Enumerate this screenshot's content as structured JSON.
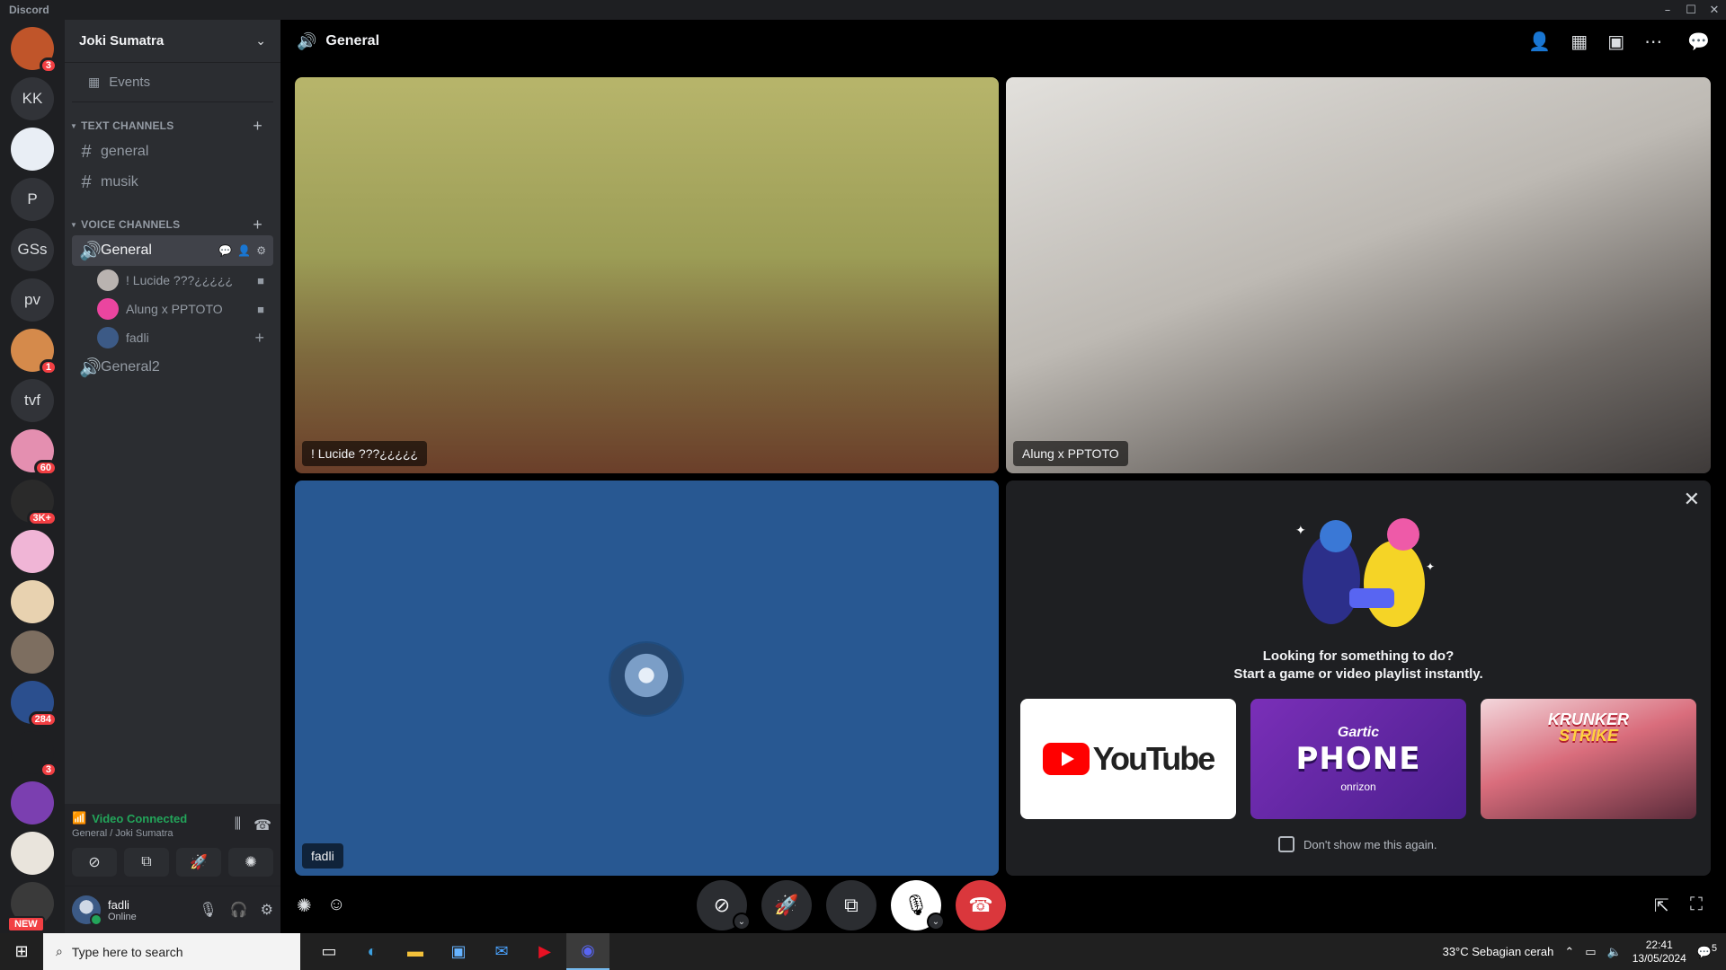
{
  "window": {
    "app_name": "Discord"
  },
  "guilds": [
    {
      "label": "",
      "badge": "3",
      "color": "#c0552a"
    },
    {
      "label": "KK",
      "badge": "",
      "color": "#313338"
    },
    {
      "label": "",
      "badge": "",
      "color": "#e9eef5"
    },
    {
      "label": "P",
      "badge": "",
      "color": "#313338"
    },
    {
      "label": "GSs",
      "badge": "",
      "color": "#313338"
    },
    {
      "label": "pv",
      "badge": "",
      "color": "#313338"
    },
    {
      "label": "",
      "badge": "1",
      "color": "#d58a4b"
    },
    {
      "label": "tvf",
      "badge": "",
      "color": "#313338"
    },
    {
      "label": "",
      "badge": "60",
      "color": "#e48fb0"
    },
    {
      "label": "",
      "badge": "3K+",
      "color": "#2a2a2a"
    },
    {
      "label": "",
      "badge": "",
      "color": "#f0b5d6"
    },
    {
      "label": "",
      "badge": "",
      "color": "#e8d2b0"
    },
    {
      "label": "",
      "badge": "",
      "color": "#7d6e60"
    },
    {
      "label": "",
      "badge": "284",
      "color": "#2b4f8e"
    },
    {
      "label": "",
      "badge": "3",
      "color": "#1e1f22"
    },
    {
      "label": "",
      "badge": "",
      "color": "#7b3fb0"
    },
    {
      "label": "",
      "badge": "",
      "color": "#e9e4dc"
    },
    {
      "label": "",
      "badge": "",
      "color": "#3a3a3a",
      "new": "NEW"
    }
  ],
  "sidebar": {
    "guild_name": "Joki Sumatra",
    "events_label": "Events",
    "text_category": "TEXT CHANNELS",
    "text_channels": [
      "general",
      "musik"
    ],
    "voice_category": "VOICE CHANNELS",
    "voice_channels": [
      "General",
      "General2"
    ],
    "members": [
      {
        "name": "! Lucide ???¿¿¿¿¿",
        "color": "#b9b3b0"
      },
      {
        "name": "Alung x PPTOTO",
        "color": "#eb459f"
      },
      {
        "name": "fadli",
        "color": "#3c5a86"
      }
    ]
  },
  "voice_panel": {
    "status": "Video Connected",
    "location": "General / Joki Sumatra"
  },
  "user_panel": {
    "name": "fadli",
    "status": "Online"
  },
  "header": {
    "channel": "General"
  },
  "tiles": {
    "lucide_name": "! Lucide ???¿¿¿¿¿",
    "alung_name": "Alung x PPTOTO",
    "fadli_name": "fadli"
  },
  "activity": {
    "line1": "Looking for something to do?",
    "line2": "Start a game or video playlist instantly.",
    "youtube_label": "YouTube",
    "gartic_top": "Gartic",
    "gartic_main": "PHONE",
    "gartic_sub": "onrizon",
    "krunker_top": "KRUNKER",
    "krunker_bottom": "STRIKE",
    "dont_show": "Don't show me this again."
  },
  "taskbar": {
    "search_placeholder": "Type here to search",
    "weather": "33°C  Sebagian cerah",
    "time": "22:41",
    "date": "13/05/2024",
    "notif_count": "5"
  },
  "colors": {
    "accent_red": "#da373c",
    "online_green": "#23a55a",
    "fadli_tile": "#285892"
  }
}
